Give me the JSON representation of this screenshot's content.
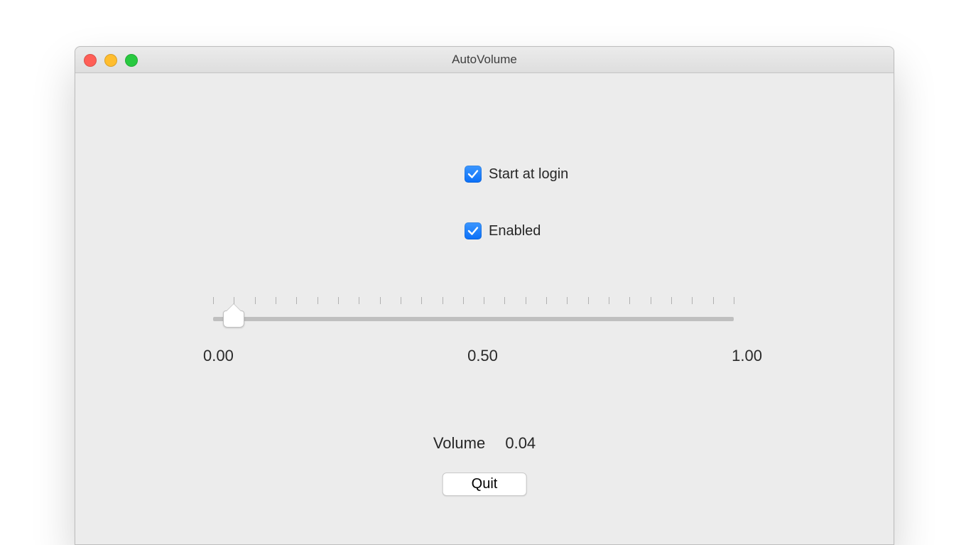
{
  "window": {
    "title": "AutoVolume"
  },
  "checkboxes": {
    "start_at_login": {
      "label": "Start at login",
      "checked": true
    },
    "enabled": {
      "label": "Enabled",
      "checked": true
    }
  },
  "slider": {
    "min": 0.0,
    "max": 1.0,
    "value": 0.04,
    "tick_count": 26,
    "labels": {
      "min": "0.00",
      "mid": "0.50",
      "max": "1.00"
    }
  },
  "volume": {
    "label": "Volume",
    "value": "0.04"
  },
  "buttons": {
    "quit": "Quit"
  }
}
